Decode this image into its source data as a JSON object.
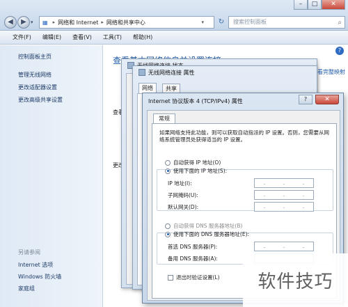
{
  "window": {
    "controls": [
      "–",
      "□",
      "✕"
    ]
  },
  "nav": {
    "back_icon": "back-arrow-icon",
    "forward_icon": "forward-arrow-icon"
  },
  "address": {
    "crumbs": [
      "网络和 Internet",
      "网络和共享中心"
    ]
  },
  "search": {
    "placeholder": "搜索控制面板"
  },
  "menu": [
    "文件(F)",
    "编辑(E)",
    "查看(V)",
    "工具(T)",
    "帮助(H)"
  ],
  "sidebar": {
    "items": [
      "控制面板主页",
      "管理无线网络",
      "更改适配器设置",
      "更改高级共享设置"
    ],
    "see_also_header": "另请参阅",
    "see_also": [
      "Internet 选项",
      "Windows 防火墙",
      "家庭组"
    ]
  },
  "main": {
    "title": "查看基本网络信息并设置连接",
    "labels": [
      "查看",
      "更改"
    ]
  },
  "bg_dialogs": {
    "status_title": "无线网络连接 状态",
    "props_title": "无线网络连接 属性",
    "tabs": [
      "网络",
      "共享"
    ],
    "link": "看完整映射"
  },
  "tcp": {
    "title": "Internet 协议版本 4 (TCP/IPv4) 属性",
    "close": "✕",
    "help": "?",
    "tab": "常规",
    "description": "如果网络支持此功能，则可以获取自动指派的 IP 设置。否则，您需要从网络系统管理员处获得适当的 IP 设置。",
    "ip_auto": "自动获得 IP 地址(O)",
    "ip_manual": "使用下面的 IP 地址(S):",
    "ip_fields": [
      "IP 地址(I):",
      "子网掩码(U):",
      "默认网关(D):"
    ],
    "dns_auto": "自动获得 DNS 服务器地址(B)",
    "dns_manual": "使用下面的 DNS 服务器地址(E):",
    "dns_fields": [
      "首选 DNS 服务器(P):",
      "备用 DNS 服务器(A):"
    ],
    "validate": "退出时验证设置(L)"
  },
  "watermark": "软件技巧"
}
